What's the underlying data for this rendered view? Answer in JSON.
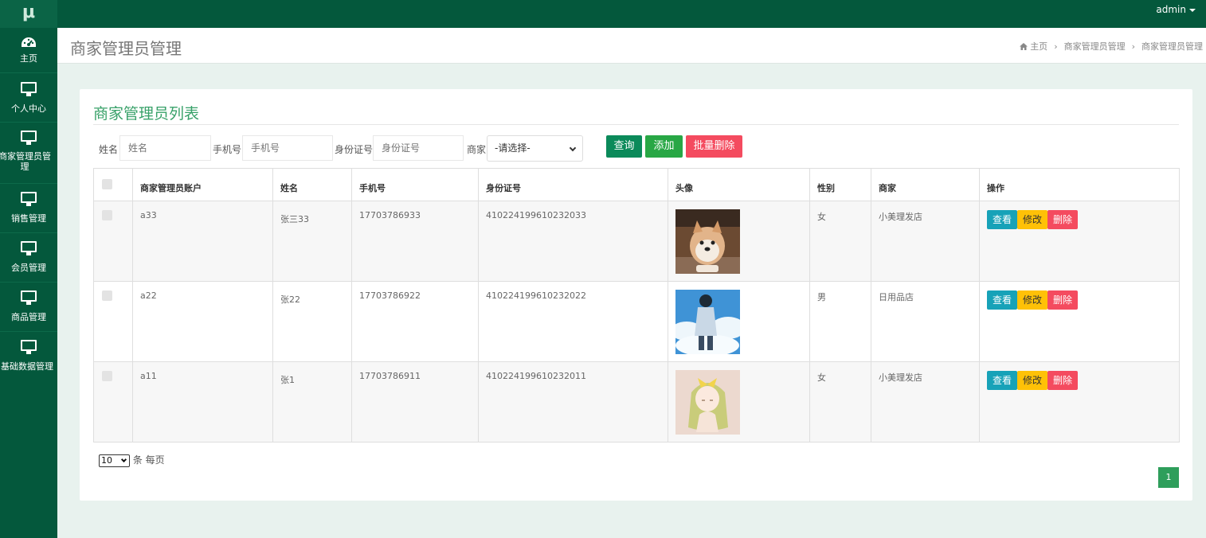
{
  "topbar": {
    "brand": "μ",
    "user": "admin"
  },
  "sidebar": {
    "items": [
      {
        "label": "主页",
        "icon": "dashboard-icon"
      },
      {
        "label": "个人中心",
        "icon": "monitor-icon"
      },
      {
        "label": "商家管理员管理",
        "icon": "monitor-icon"
      },
      {
        "label": "销售管理",
        "icon": "monitor-icon"
      },
      {
        "label": "会员管理",
        "icon": "monitor-icon"
      },
      {
        "label": "商品管理",
        "icon": "monitor-icon"
      },
      {
        "label": "基础数据管理",
        "icon": "monitor-icon"
      }
    ]
  },
  "page": {
    "title": "商家管理员管理",
    "breadcrumb": [
      "主页",
      "商家管理员管理",
      "商家管理员管理"
    ]
  },
  "panel": {
    "title": "商家管理员列表"
  },
  "filters": {
    "name_label": "姓名",
    "name_placeholder": "姓名",
    "phone_label": "手机号",
    "phone_placeholder": "手机号",
    "id_label": "身份证号",
    "id_placeholder": "身份证号",
    "shop_label": "商家",
    "shop_selected": "-请选择-"
  },
  "buttons": {
    "search": "查询",
    "add": "添加",
    "batch_delete": "批量删除"
  },
  "table": {
    "columns": [
      "商家管理员账户",
      "姓名",
      "手机号",
      "身份证号",
      "头像",
      "性别",
      "商家",
      "操作"
    ],
    "rows": [
      {
        "account": "a33",
        "name": "张三33",
        "phone": "17703786933",
        "id_no": "410224199610232033",
        "gender": "女",
        "shop": "小美理发店"
      },
      {
        "account": "a22",
        "name": "张22",
        "phone": "17703786922",
        "id_no": "410224199610232022",
        "gender": "男",
        "shop": "日用品店"
      },
      {
        "account": "a11",
        "name": "张1",
        "phone": "17703786911",
        "id_no": "410224199610232011",
        "gender": "女",
        "shop": "小美理发店"
      }
    ],
    "actions": {
      "view": "查看",
      "edit": "修改",
      "delete": "删除"
    }
  },
  "pager": {
    "page_size": "10",
    "per_page_label": "条 每页",
    "current_page": "1"
  },
  "colors": {
    "primary": "#04583c",
    "accent": "#38a169",
    "info": "#17a2b8",
    "warning": "#ffc107",
    "danger": "#f44b5f"
  }
}
